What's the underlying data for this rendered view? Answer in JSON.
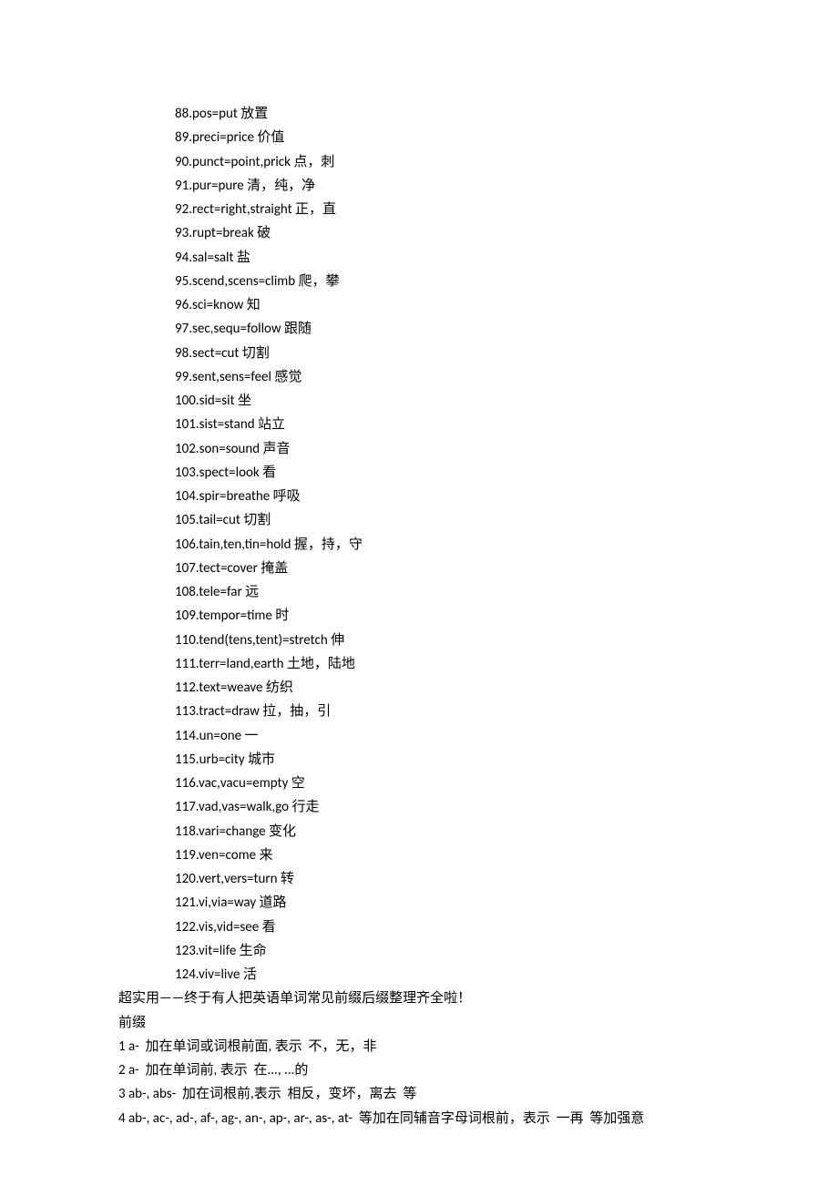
{
  "roots": [
    "88.pos=put 放置",
    "89.preci=price 价值",
    "90.punct=point,prick 点，刺",
    "91.pur=pure 清，纯，净",
    "92.rect=right,straight 正，直",
    "93.rupt=break 破",
    "94.sal=salt 盐",
    "95.scend,scens=climb 爬，攀",
    "96.sci=know 知",
    "97.sec,sequ=follow 跟随",
    "98.sect=cut 切割",
    "99.sent,sens=feel 感觉",
    "100.sid=sit 坐",
    "101.sist=stand 站立",
    "102.son=sound 声音",
    "103.spect=look 看",
    "104.spir=breathe 呼吸",
    "105.tail=cut 切割",
    "106.tain,ten,tin=hold 握，持，守",
    "107.tect=cover 掩盖",
    "108.tele=far 远",
    "109.tempor=time 时",
    "110.tend(tens,tent)=stretch 伸",
    "111.terr=land,earth 土地，陆地",
    "112.text=weave 纺织",
    "113.tract=draw 拉，抽，引",
    "114.un=one 一",
    "115.urb=city 城市",
    "116.vac,vacu=empty 空",
    "117.vad,vas=walk,go 行走",
    "118.vari=change 变化",
    "119.ven=come 来",
    "120.vert,vers=turn 转",
    "121.vi,via=way 道路",
    "122.vis,vid=see 看",
    "123.vit=life 生命",
    "124.viv=live 活"
  ],
  "heading1": "超实用——终于有人把英语单词常见前缀后缀整理齐全啦！",
  "heading2": "前缀",
  "prefixes": [
    "1 a-  加在单词或词根前面, 表示  不，无，非",
    "2 a-  加在单词前, 表示  在..., ...的",
    "3 ab-, abs-  加在词根前,表示  相反，变坏，离去  等",
    "4 ab-, ac-, ad-, af-, ag-, an-, ap-, ar-, as-, at-  等加在同辅音字母词根前，表示  一再  等加强意"
  ]
}
